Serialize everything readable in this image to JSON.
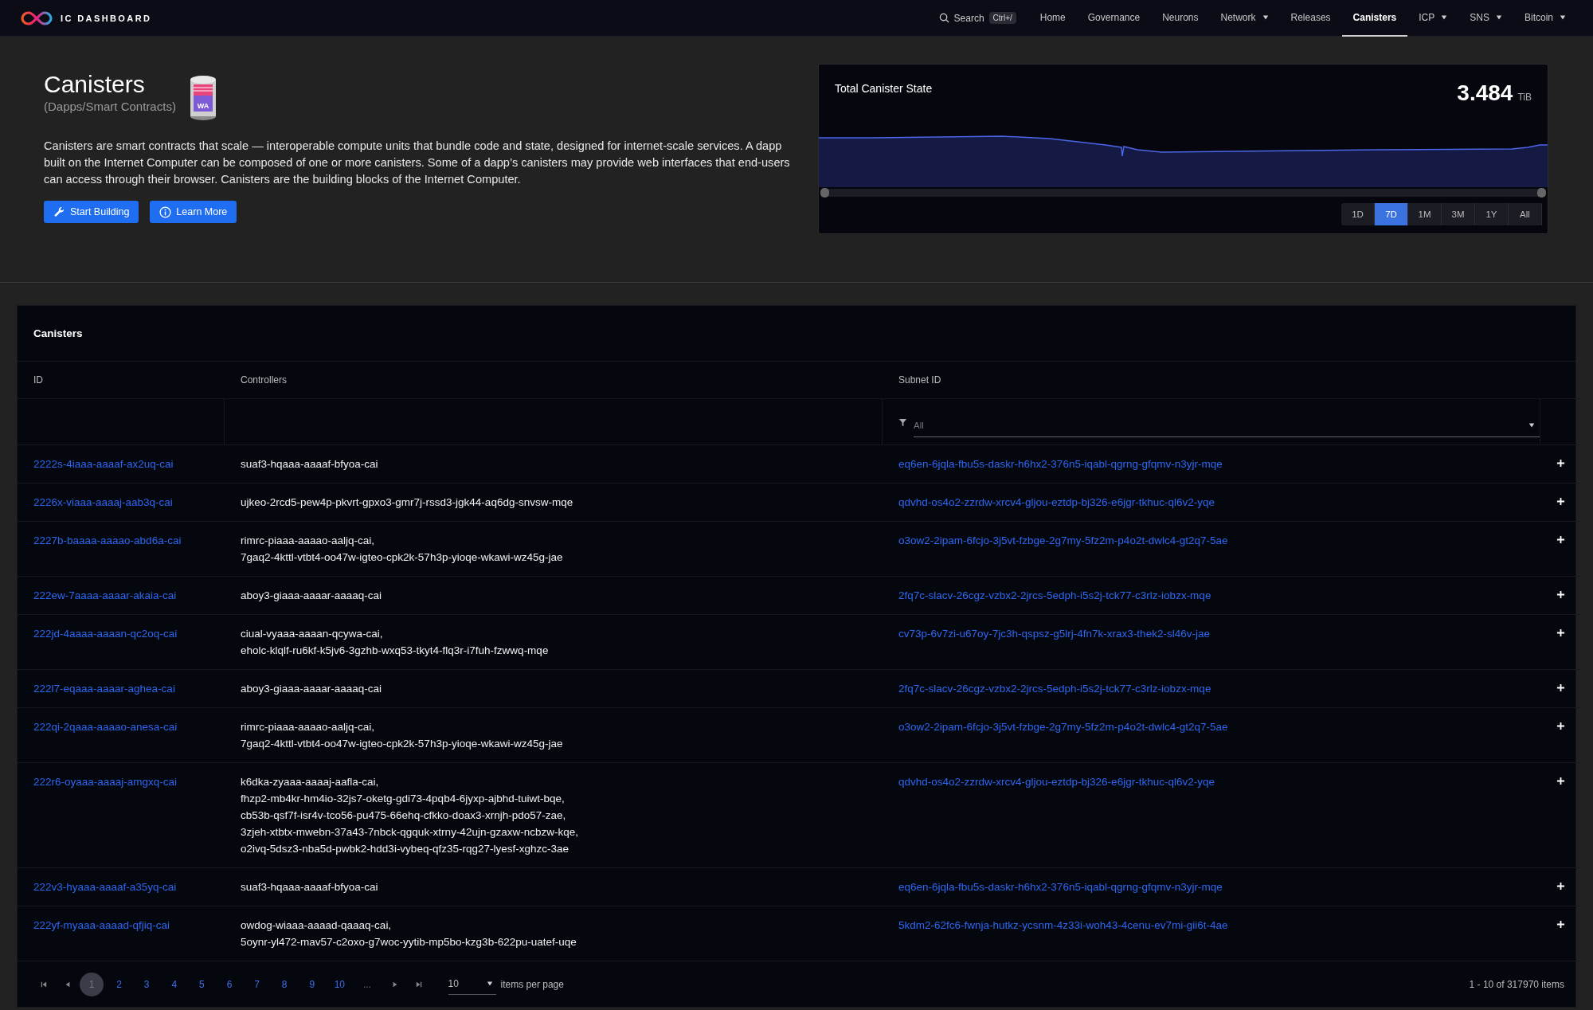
{
  "nav": {
    "logo": "IC DASHBOARD",
    "search": {
      "label": "Search",
      "shortcut": "Ctrl+/"
    },
    "items": [
      {
        "label": "Home",
        "selected": false,
        "dropdown": false
      },
      {
        "label": "Governance",
        "selected": false,
        "dropdown": false
      },
      {
        "label": "Neurons",
        "selected": false,
        "dropdown": false
      },
      {
        "label": "Network",
        "selected": false,
        "dropdown": true
      },
      {
        "label": "Releases",
        "selected": false,
        "dropdown": false
      },
      {
        "label": "Canisters",
        "selected": true,
        "dropdown": false
      },
      {
        "label": "ICP",
        "selected": false,
        "dropdown": true
      },
      {
        "label": "SNS",
        "selected": false,
        "dropdown": true
      },
      {
        "label": "Bitcoin",
        "selected": false,
        "dropdown": true
      }
    ]
  },
  "hero": {
    "title": "Canisters",
    "subtitle": "(Dapps/Smart Contracts)",
    "icon_label": "WA",
    "description": "Canisters are smart contracts that scale — interoperable compute units that bundle code and state, designed for internet-scale services. A dapp built on the Internet Computer can be composed of one or more canisters. Some of a dapp’s canisters may provide web interfaces that end-users can access through their browser. Canisters are the building blocks of the Internet Computer.",
    "buttons": [
      {
        "label": "Start Building",
        "kind": "wrench"
      },
      {
        "label": "Learn More",
        "kind": "info"
      }
    ]
  },
  "chart_card": {
    "title": "Total Canister State",
    "value": "3.484",
    "unit": "TiB",
    "navigator": {
      "level": 1
    },
    "ranges": [
      {
        "label": "1D",
        "selected": false
      },
      {
        "label": "7D",
        "selected": true
      },
      {
        "label": "1M",
        "selected": false
      },
      {
        "label": "3M",
        "selected": false
      },
      {
        "label": "1Y",
        "selected": false
      },
      {
        "label": "All",
        "selected": false
      }
    ]
  },
  "table": {
    "title": "Canisters",
    "columns": [
      "ID",
      "Controllers",
      "Subnet ID"
    ],
    "filter": {
      "placeholder": "All"
    },
    "rows": [
      {
        "id": "2222s-4iaaa-aaaaf-ax2uq-cai",
        "controllers": [
          "suaf3-hqaaa-aaaaf-bfyoa-cai"
        ],
        "subnet": "eq6en-6jqla-fbu5s-daskr-h6hx2-376n5-iqabl-qgrng-gfqmv-n3yjr-mqe"
      },
      {
        "id": "2226x-viaaa-aaaaj-aab3q-cai",
        "controllers": [
          "ujkeo-2rcd5-pew4p-pkvrt-gpxo3-gmr7j-rssd3-jgk44-aq6dg-snvsw-mqe"
        ],
        "subnet": "qdvhd-os4o2-zzrdw-xrcv4-gljou-eztdp-bj326-e6jgr-tkhuc-ql6v2-yqe"
      },
      {
        "id": "2227b-baaaa-aaaao-abd6a-cai",
        "controllers": [
          "rimrc-piaaa-aaaao-aaljq-cai,",
          "7gaq2-4kttl-vtbt4-oo47w-igteo-cpk2k-57h3p-yioqe-wkawi-wz45g-jae"
        ],
        "subnet": "o3ow2-2ipam-6fcjo-3j5vt-fzbge-2g7my-5fz2m-p4o2t-dwlc4-gt2q7-5ae"
      },
      {
        "id": "222ew-7aaaa-aaaar-akaia-cai",
        "controllers": [
          "aboy3-giaaa-aaaar-aaaaq-cai"
        ],
        "subnet": "2fq7c-slacv-26cgz-vzbx2-2jrcs-5edph-i5s2j-tck77-c3rlz-iobzx-mqe"
      },
      {
        "id": "222jd-4aaaa-aaaan-qc2oq-cai",
        "controllers": [
          "ciual-vyaaa-aaaan-qcywa-cai,",
          "eholc-klqlf-ru6kf-k5jv6-3gzhb-wxq53-tkyt4-flq3r-i7fuh-fzwwq-mqe"
        ],
        "subnet": "cv73p-6v7zi-u67oy-7jc3h-qspsz-g5lrj-4fn7k-xrax3-thek2-sl46v-jae"
      },
      {
        "id": "222l7-eqaaa-aaaar-aghea-cai",
        "controllers": [
          "aboy3-giaaa-aaaar-aaaaq-cai"
        ],
        "subnet": "2fq7c-slacv-26cgz-vzbx2-2jrcs-5edph-i5s2j-tck77-c3rlz-iobzx-mqe"
      },
      {
        "id": "222qi-2qaaa-aaaao-anesa-cai",
        "controllers": [
          "rimrc-piaaa-aaaao-aaljq-cai,",
          "7gaq2-4kttl-vtbt4-oo47w-igteo-cpk2k-57h3p-yioqe-wkawi-wz45g-jae"
        ],
        "subnet": "o3ow2-2ipam-6fcjo-3j5vt-fzbge-2g7my-5fz2m-p4o2t-dwlc4-gt2q7-5ae"
      },
      {
        "id": "222r6-oyaaa-aaaaj-amgxq-cai",
        "controllers": [
          "k6dka-zyaaa-aaaaj-aafla-cai,",
          "fhzp2-mb4kr-hm4io-32js7-oketg-gdi73-4pqb4-6jyxp-ajbhd-tuiwt-bqe,",
          "cb53b-qsf7f-isr4v-tco56-pu475-66ehq-cfkko-doax3-xrnjh-pdo57-zae,",
          "3zjeh-xtbtx-mwebn-37a43-7nbck-qgquk-xtrny-42ujn-gzaxw-ncbzw-kqe,",
          "o2ivq-5dsz3-nba5d-pwbk2-hdd3i-vybeq-qfz35-rqg27-lyesf-xghzc-3ae"
        ],
        "subnet": "qdvhd-os4o2-zzrdw-xrcv4-gljou-eztdp-bj326-e6jgr-tkhuc-ql6v2-yqe"
      },
      {
        "id": "222v3-hyaaa-aaaaf-a35yq-cai",
        "controllers": [
          "suaf3-hqaaa-aaaaf-bfyoa-cai"
        ],
        "subnet": "eq6en-6jqla-fbu5s-daskr-h6hx2-376n5-iqabl-qgrng-gfqmv-n3yjr-mqe"
      },
      {
        "id": "222yf-myaaa-aaaad-qfjiq-cai",
        "controllers": [
          "owdog-wiaaa-aaaad-qaaaq-cai,",
          "5oynr-yl472-mav57-c2oxo-g7woc-yytib-mp5bo-kzg3b-622pu-uatef-uqe"
        ],
        "subnet": "5kdm2-62fc6-fwnja-hutkz-ycsnm-4z33i-woh43-4cenu-ev7mi-gii6t-4ae"
      }
    ]
  },
  "pagination": {
    "pages": [
      {
        "label": "1",
        "selected": true
      },
      {
        "label": "2",
        "selected": false
      },
      {
        "label": "3",
        "selected": false
      },
      {
        "label": "4",
        "selected": false
      },
      {
        "label": "5",
        "selected": false
      },
      {
        "label": "6",
        "selected": false
      },
      {
        "label": "7",
        "selected": false
      },
      {
        "label": "8",
        "selected": false
      },
      {
        "label": "9",
        "selected": false
      },
      {
        "label": "10",
        "selected": false
      },
      {
        "label": "...",
        "selected": false
      }
    ],
    "page_size": "10",
    "page_size_label": "items per page",
    "summary": "1 - 10 of 317970 items"
  }
}
